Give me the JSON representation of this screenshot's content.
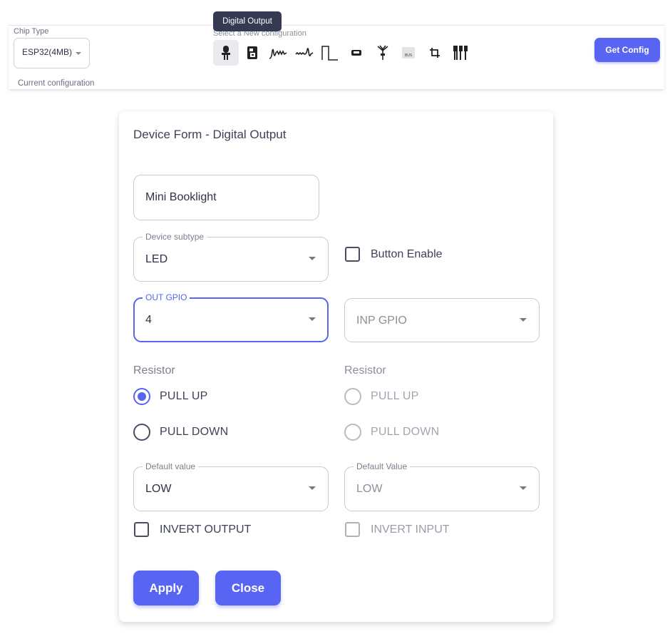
{
  "toolbar": {
    "chip_type_label": "Chip Type",
    "chip_type_value": "ESP32(4MB)",
    "current_configuration_label": "Current configuration",
    "select_new_label": "Select a New configuration",
    "tooltip": "Digital Output",
    "get_config_label": "Get Config",
    "accent_color": "#5765f2",
    "device_icons": [
      {
        "name": "digital-output-icon",
        "active": true
      },
      {
        "name": "digital-input-icon"
      },
      {
        "name": "pwm-output-icon"
      },
      {
        "name": "analog-input-icon"
      },
      {
        "name": "pulse-icon"
      },
      {
        "name": "sensor-icon"
      },
      {
        "name": "antenna-icon"
      },
      {
        "name": "bus-icon"
      },
      {
        "name": "i2c-icon"
      },
      {
        "name": "multi-pin-icon"
      }
    ]
  },
  "form": {
    "title": "Device Form - Digital Output",
    "device_name": "Mini Booklight",
    "device_subtype_label": "Device subtype",
    "device_subtype_value": "LED",
    "button_enable_label": "Button Enable",
    "button_enable_checked": false,
    "out_gpio_label": "OUT GPIO",
    "out_gpio_value": "4",
    "inp_gpio_placeholder": "INP GPIO",
    "left_resistor_label": "Resistor",
    "right_resistor_label": "Resistor",
    "pull_up_label": "PULL UP",
    "pull_down_label": "PULL DOWN",
    "left_resistor_selected": "PULL UP",
    "left_default_value_label": "Default value",
    "left_default_value": "LOW",
    "right_default_value_label": "Default Value",
    "right_default_value": "LOW",
    "invert_output_label": "INVERT OUTPUT",
    "invert_input_label": "INVERT INPUT",
    "apply_label": "Apply",
    "close_label": "Close"
  }
}
